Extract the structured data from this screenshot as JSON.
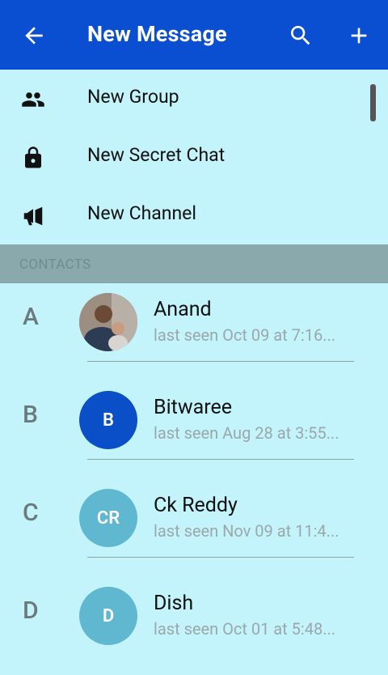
{
  "appbar": {
    "title": "New Message",
    "back_icon": "arrow-back-icon",
    "search_icon": "search-icon",
    "add_icon": "plus-icon",
    "color": "#0a4fd1"
  },
  "menu": [
    {
      "label": "New Group",
      "icon": "group-icon"
    },
    {
      "label": "New Secret Chat",
      "icon": "lock-icon"
    },
    {
      "label": "New Channel",
      "icon": "megaphone-icon"
    }
  ],
  "section": {
    "label": "CONTACTS"
  },
  "contacts": [
    {
      "letter": "A",
      "name": "Anand",
      "status": "last seen Oct 09 at 7:16...",
      "avatar": "photo",
      "initials": ""
    },
    {
      "letter": "B",
      "name": "Bitwaree",
      "status": "last seen Aug 28 at 3:55...",
      "avatar": "#0a4fc8",
      "initials": "B"
    },
    {
      "letter": "C",
      "name": "Ck Reddy",
      "status": "last seen Nov 09 at 11:4...",
      "avatar": "#5fb8d0",
      "initials": "CR"
    },
    {
      "letter": "D",
      "name": "Dish",
      "status": "last seen Oct 01 at 5:48...",
      "avatar": "#5fb8d0",
      "initials": "D"
    }
  ]
}
